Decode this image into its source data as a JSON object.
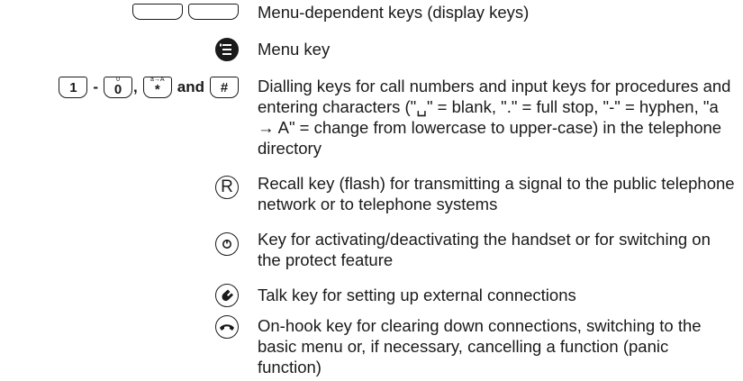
{
  "rows": [
    {
      "desc": "Menu-dependent keys (display keys)",
      "icons": [
        "display-key-icon",
        "display-key-icon"
      ]
    },
    {
      "desc": "Menu key",
      "icons": [
        "menu-key-icon"
      ]
    },
    {
      "keys": {
        "first": "1",
        "dash": "-",
        "zero": "0",
        "zero_sup": "0̈",
        "star": "*",
        "star_sup": "a→A",
        "comma": ",",
        "and": "and",
        "hash": "#"
      },
      "desc": "Dialling keys for call numbers and input keys for procedures and entering characters (\"␣\" = blank, \".\" = full stop, \"-\" = hyphen, \"a → A\" = change from lowercase to upper-case) in the telephone directory"
    },
    {
      "desc": "Recall key (flash) for transmitting a signal to the public telephone network or to telephone systems",
      "key_label": "R"
    },
    {
      "desc": "Key for activating/deactivating the handset or for switching on the protect feature",
      "icons": [
        "on-off-key-icon"
      ]
    },
    {
      "desc": "Talk key for setting up external connections",
      "icons": [
        "talk-key-icon"
      ]
    },
    {
      "desc": "On-hook key for clearing down connections, switching to the basic menu or, if necessary, cancelling a function (panic function)",
      "icons": [
        "on-hook-key-icon"
      ]
    }
  ]
}
